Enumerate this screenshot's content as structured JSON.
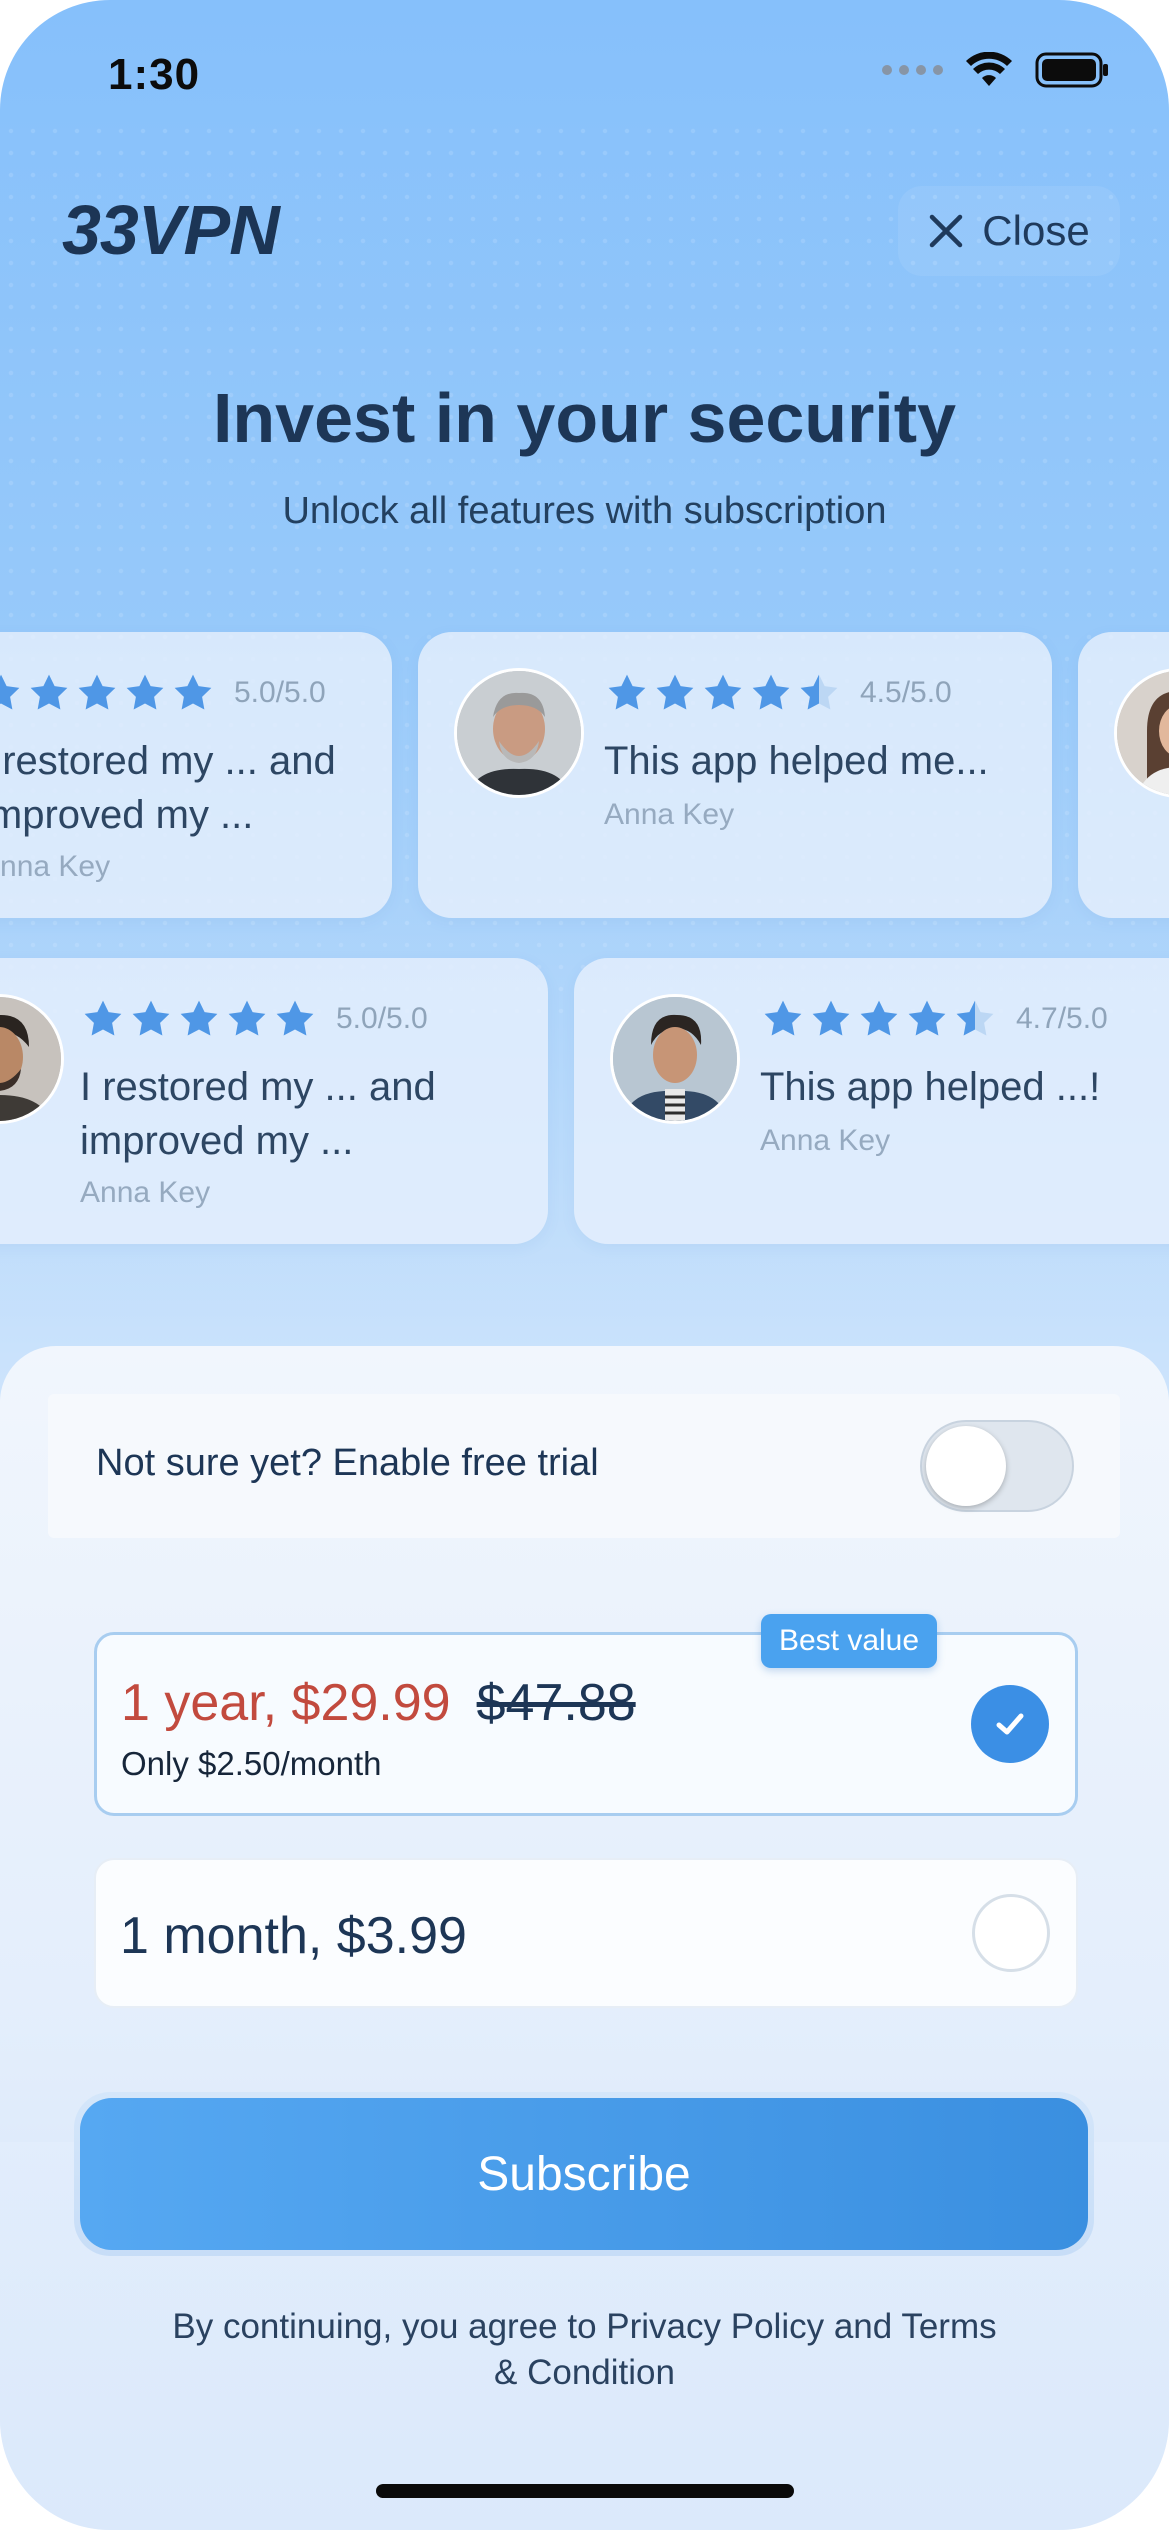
{
  "status_bar": {
    "time": "1:30"
  },
  "header": {
    "logo": "33VPN",
    "close_label": "Close"
  },
  "hero": {
    "title": "Invest in your security",
    "subtitle": "Unlock all features with subscription"
  },
  "reviews_row1": [
    {
      "rating": "5.0/5.0",
      "stars": 5,
      "text_line1": "I restored my ... and",
      "text_line2": "improved my ...",
      "author": "Anna Key"
    },
    {
      "rating": "4.5/5.0",
      "stars": 4.5,
      "text_line1": "This app helped me...",
      "text_line2": "",
      "author": "Anna Key"
    }
  ],
  "reviews_row2": [
    {
      "rating": "5.0/5.0",
      "stars": 5,
      "text_line1": "I restored my ... and",
      "text_line2": "improved my ...",
      "author": "Anna Key"
    },
    {
      "rating": "4.7/5.0",
      "stars": 4.7,
      "text_line1": "This app helped ...!",
      "text_line2": "",
      "author": "Anna Key"
    }
  ],
  "trial": {
    "label": "Not sure yet? Enable free trial",
    "enabled": false
  },
  "plans": {
    "badge": "Best value",
    "yearly": {
      "price": "1 year, $29.99",
      "old_price": "$47.88",
      "per_month": "Only $2.50/month",
      "selected": true
    },
    "monthly": {
      "price": "1 month, $3.99",
      "selected": false
    }
  },
  "cta": {
    "subscribe_label": "Subscribe"
  },
  "legal": {
    "line1": "By continuing, you agree to Privacy Policy and Terms",
    "line2": "& Condition"
  },
  "colors": {
    "accent": "#3b8fe5",
    "price_red": "#c24a3e",
    "title": "#1d3656"
  }
}
